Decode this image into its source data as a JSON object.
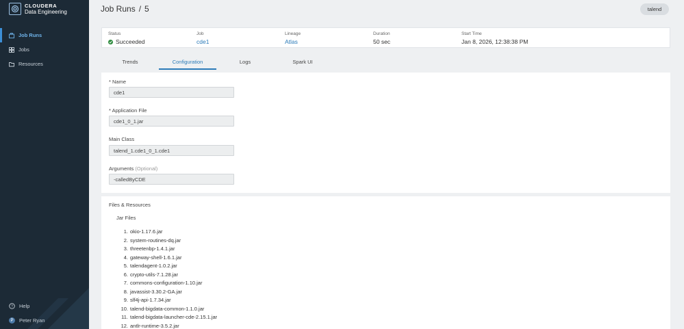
{
  "brand": {
    "line1": "CLOUDERA",
    "line2": "Data Engineering"
  },
  "nav": {
    "job_runs": "Job Runs",
    "jobs": "Jobs",
    "resources": "Resources"
  },
  "sidebar_bottom": {
    "help": "Help",
    "user": "Peter Ryan",
    "user_initial": "P"
  },
  "header": {
    "crumb": "Job Runs",
    "separator": "/",
    "run_id": "5"
  },
  "user_pill": "talend",
  "status": {
    "status_label": "Status",
    "status_value": "Succeeded",
    "job_label": "Job",
    "job_value": "cde1",
    "lineage_label": "Lineage",
    "lineage_value": "Atlas",
    "duration_label": "Duration",
    "duration_value": "50 sec",
    "start_label": "Start Time",
    "start_value": "Jan 8, 2026, 12:38:38 PM"
  },
  "tabs": [
    "Trends",
    "Configuration",
    "Logs",
    "Spark UI"
  ],
  "config": {
    "name_label": "* Name",
    "name_value": "cde1",
    "app_label": "* Application File",
    "app_value": "cde1_0_1.jar",
    "main_label": "Main Class",
    "main_value": "talend_1.cde1_0_1.cde1",
    "args_label": "Arguments",
    "args_optional": "(Optional)",
    "args_value": "-calledByCDE"
  },
  "files": {
    "title": "Files & Resources",
    "jar_title": "Jar Files",
    "jars": [
      "okio-1.17.6.jar",
      "system-routines-dq.jar",
      "threetenbp-1.4.1.jar",
      "gateway-shell-1.6.1.jar",
      "talendagent-1.0.2.jar",
      "crypto-utils-7.1.28.jar",
      "commons-configuration-1.10.jar",
      "javassist-3.30.2-GA.jar",
      "slf4j-api-1.7.34.jar",
      "talend-bigdata-common-1.1.0.jar",
      "talend-bigdata-launcher-cde-2.15.1.jar",
      "antlr-runtime-3.5.2.jar"
    ]
  },
  "colors": {
    "sidebar": "#1c2a36",
    "accent": "#2a7ab8",
    "success": "#2e8b3e"
  }
}
